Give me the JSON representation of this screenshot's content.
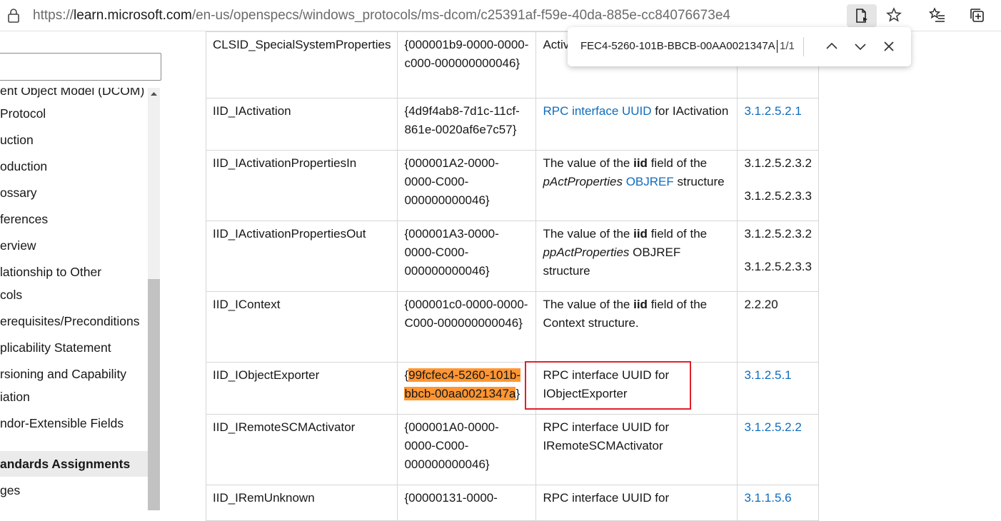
{
  "address_bar": {
    "url_prefix": "https://",
    "url_host": "learn.microsoft.com",
    "url_path": "/en-us/openspecs/windows_protocols/ms-dcom/c25391af-f59e-40da-885e-cc84076673e4",
    "icons": [
      "lock-icon",
      "read-aloud-icon",
      "favorite-star-icon",
      "favorites-list-icon",
      "collections-icon"
    ]
  },
  "find_bar": {
    "query": "FEC4-5260-101B-BBCB-00AA0021347A",
    "count": "1/1",
    "icons": [
      "previous-match-icon",
      "next-match-icon",
      "close-icon"
    ]
  },
  "sidebar": {
    "items": [
      {
        "label": "ent Object Model (DCOM)",
        "selected": false
      },
      {
        "label": "Protocol",
        "selected": false
      },
      {
        "label": "uction",
        "selected": false
      },
      {
        "label": "oduction",
        "selected": false
      },
      {
        "label": "ossary",
        "selected": false
      },
      {
        "label": "ferences",
        "selected": false
      },
      {
        "label": "erview",
        "selected": false
      },
      {
        "label": "lationship to Other",
        "selected": false
      },
      {
        "label": "cols",
        "selected": false
      },
      {
        "label": "erequisites/Preconditions",
        "selected": false
      },
      {
        "label": "plicability Statement",
        "selected": false
      },
      {
        "label": "rsioning and Capability",
        "selected": false
      },
      {
        "label": "iation",
        "selected": false
      },
      {
        "label": "ndor-Extensible Fields",
        "selected": false
      },
      {
        "label": "andards Assignments",
        "selected": true
      },
      {
        "label": "ges",
        "selected": false
      }
    ]
  },
  "table": {
    "rows": [
      {
        "name": "CLSID_SpecialSystemProperties",
        "uuid": "{000001b9-0000-0000-c000-000000000046}",
        "desc_link": "",
        "desc_text": "Activ… Special… PropertiesData.",
        "refs": []
      },
      {
        "name": "IID_IActivation",
        "uuid": "{4d9f4ab8-7d1c-11cf-861e-0020af6e7c57}",
        "desc_link": "RPC interface UUID",
        "desc_text": "for IActivation",
        "refs": [
          "3.1.2.5.2.1"
        ]
      },
      {
        "name": "IID_IActivationPropertiesIn",
        "uuid": "{000001A2-0000-0000-C000-000000000046}",
        "desc_pre": "The value of the",
        "desc_bold": "iid",
        "desc_mid": "field of the",
        "desc_italic": "pActProperties",
        "desc_link": "OBJREF",
        "desc_post": "structure",
        "refs": [
          "3.1.2.5.2.3.2",
          "3.1.2.5.2.3.3"
        ]
      },
      {
        "name": "IID_IActivationPropertiesOut",
        "uuid": "{000001A3-0000-0000-C000-000000000046}",
        "desc_pre": "The value of the",
        "desc_bold": "iid",
        "desc_mid": "field of the",
        "desc_italic": "ppActProperties",
        "desc_post": "OBJREF structure",
        "refs": [
          "3.1.2.5.2.3.2",
          "3.1.2.5.2.3.3"
        ]
      },
      {
        "name": "IID_IContext",
        "uuid": "{000001c0-0000-0000-C000-000000000046}",
        "desc_pre": "The value of the",
        "desc_bold": "iid",
        "desc_post": "field of the Context structure.",
        "refs": [
          "2.2.20"
        ]
      },
      {
        "name": "IID_IObjectExporter",
        "uuid_open": "{",
        "uuid_highlight": "99fcfec4-5260-101b-bbcb-00aa0021347a",
        "uuid_close": "}",
        "desc_text": "RPC interface UUID for IObjectExporter",
        "refs": [
          "3.1.2.5.1"
        ]
      },
      {
        "name": "IID_IRemoteSCMActivator",
        "uuid": "{000001A0-0000-0000-C000-000000000046}",
        "desc_text": "RPC interface UUID for IRemoteSCMActivator",
        "refs": [
          "3.1.2.5.2.2"
        ]
      },
      {
        "name": "IID_IRemUnknown",
        "uuid": "{00000131-0000-",
        "desc_text": "RPC interface UUID for",
        "refs": [
          "3.1.1.5.6"
        ]
      }
    ]
  },
  "colors": {
    "link": "#0f6cbd",
    "highlight": "#ff9632",
    "annotation_box": "#e0202a"
  }
}
